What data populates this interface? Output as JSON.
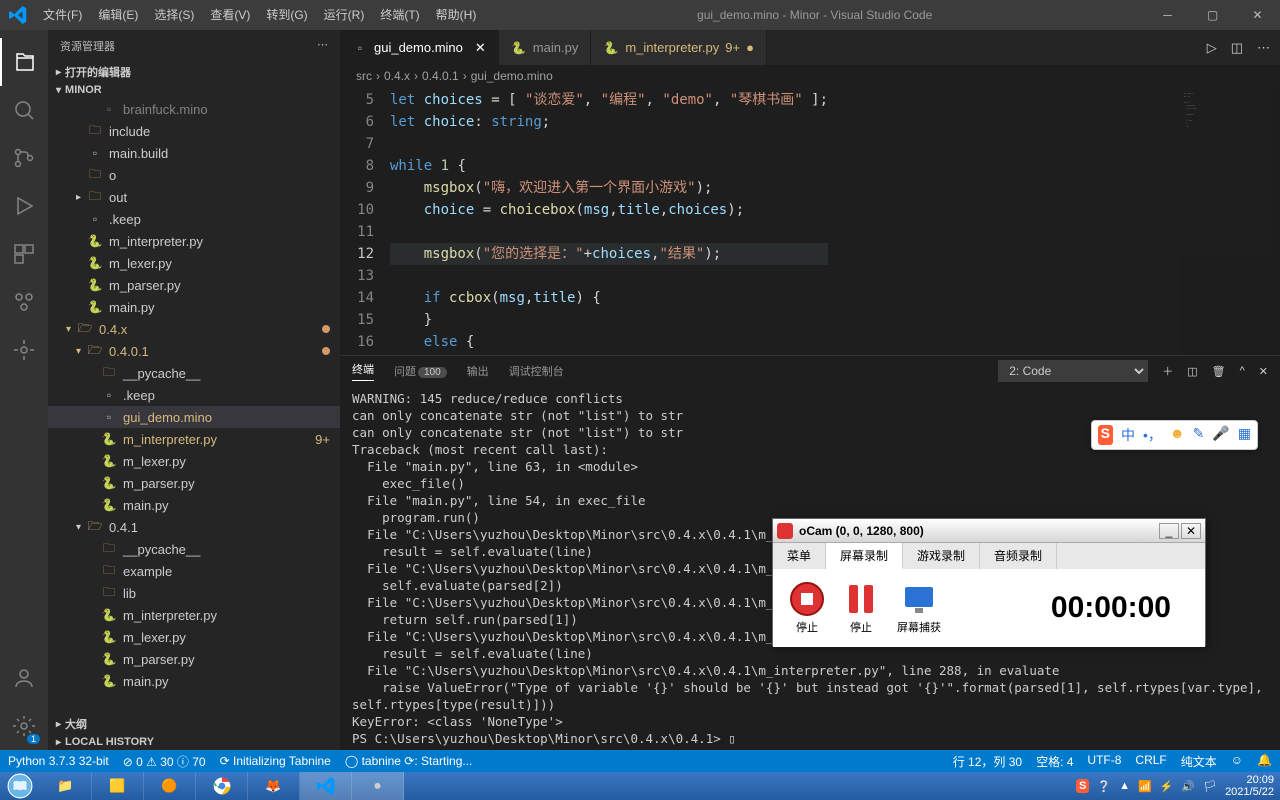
{
  "titlebar": {
    "menus": [
      "文件(F)",
      "编辑(E)",
      "选择(S)",
      "查看(V)",
      "转到(G)",
      "运行(R)",
      "终端(T)",
      "帮助(H)"
    ],
    "title": "gui_demo.mino - Minor - Visual Studio Code"
  },
  "sidebar": {
    "header": "资源管理器",
    "open_editors": "打开的编辑器",
    "workspace": "MINOR",
    "outline": "大纲",
    "localhistory": "LOCAL HISTORY",
    "tree": [
      {
        "depth": 2,
        "icon": "file",
        "label": "brainfuck.mino",
        "dim": true
      },
      {
        "depth": 1,
        "icon": "folder",
        "label": "include"
      },
      {
        "depth": 1,
        "icon": "file",
        "label": "main.build"
      },
      {
        "depth": 1,
        "icon": "folder",
        "label": "o"
      },
      {
        "depth": 1,
        "icon": "folder",
        "label": "out",
        "expandable": true
      },
      {
        "depth": 1,
        "icon": "file",
        "label": ".keep"
      },
      {
        "depth": 1,
        "icon": "py",
        "label": "m_interpreter.py"
      },
      {
        "depth": 1,
        "icon": "py",
        "label": "m_lexer.py"
      },
      {
        "depth": 1,
        "icon": "py",
        "label": "m_parser.py"
      },
      {
        "depth": 1,
        "icon": "py",
        "label": "main.py"
      },
      {
        "depth": 0,
        "icon": "folder-open",
        "label": "0.4.x",
        "yellow": true,
        "dot": true
      },
      {
        "depth": 1,
        "icon": "folder-open",
        "label": "0.4.0.1",
        "yellow": true,
        "dot": true
      },
      {
        "depth": 2,
        "icon": "folder",
        "label": "__pycache__"
      },
      {
        "depth": 2,
        "icon": "file",
        "label": ".keep"
      },
      {
        "depth": 2,
        "icon": "file",
        "label": "gui_demo.mino",
        "yellow": true,
        "active": true
      },
      {
        "depth": 2,
        "icon": "py",
        "label": "m_interpreter.py",
        "yellow": true,
        "badge": "9+"
      },
      {
        "depth": 2,
        "icon": "py",
        "label": "m_lexer.py"
      },
      {
        "depth": 2,
        "icon": "py",
        "label": "m_parser.py"
      },
      {
        "depth": 2,
        "icon": "py",
        "label": "main.py"
      },
      {
        "depth": 1,
        "icon": "folder-open",
        "label": "0.4.1"
      },
      {
        "depth": 2,
        "icon": "folder",
        "label": "__pycache__"
      },
      {
        "depth": 2,
        "icon": "folder",
        "label": "example"
      },
      {
        "depth": 2,
        "icon": "folder",
        "label": "lib"
      },
      {
        "depth": 2,
        "icon": "py",
        "label": "m_interpreter.py"
      },
      {
        "depth": 2,
        "icon": "py",
        "label": "m_lexer.py"
      },
      {
        "depth": 2,
        "icon": "py",
        "label": "m_parser.py"
      },
      {
        "depth": 2,
        "icon": "py",
        "label": "main.py"
      }
    ]
  },
  "tabs": [
    {
      "icon": "file",
      "label": "gui_demo.mino",
      "active": true,
      "close": true
    },
    {
      "icon": "py",
      "label": "main.py"
    },
    {
      "icon": "py",
      "label": "m_interpreter.py",
      "mod": true,
      "badge": "9+"
    }
  ],
  "breadcrumb": [
    "src",
    "0.4.x",
    "0.4.0.1",
    "gui_demo.mino"
  ],
  "code": {
    "start": 5,
    "current": 12,
    "linesHtml": [
      "<span class='kw'>let</span> <span class='id'>choices</span> <span class='punc'>=</span> <span class='punc'>[</span> <span class='str'>\"谈恋爱\"</span><span class='punc'>,</span> <span class='str'>\"编程\"</span><span class='punc'>,</span> <span class='str'>\"demo\"</span><span class='punc'>,</span> <span class='str'>\"琴棋书画\"</span> <span class='punc'>]</span><span class='punc'>;</span>",
      "<span class='kw'>let</span> <span class='id'>choice</span><span class='punc'>:</span> <span class='kw'>string</span><span class='punc'>;</span>",
      "",
      "<span class='kw'>while</span> <span class='num'>1</span> <span class='punc'>{</span>",
      "    <span class='fn'>msgbox</span><span class='punc'>(</span><span class='str'>\"嗨，欢迎进入第一个界面小游戏\"</span><span class='punc'>)</span><span class='punc'>;</span>",
      "    <span class='id'>choice</span> <span class='punc'>=</span> <span class='fn'>choicebox</span><span class='punc'>(</span><span class='id'>msg</span><span class='punc'>,</span><span class='id'>title</span><span class='punc'>,</span><span class='id'>choices</span><span class='punc'>)</span><span class='punc'>;</span>",
      "",
      "    <span class='fn'>msgbox</span><span class='punc'>(</span><span class='str'>\"您的选择是：\"</span><span class='punc'>+</span><span class='id'>choices</span><span class='punc'>,</span><span class='str'>\"结果\"</span><span class='punc'>)</span><span class='punc'>;</span>",
      "",
      "    <span class='kw'>if</span> <span class='fn'>ccbox</span><span class='punc'>(</span><span class='id'>msg</span><span class='punc'>,</span><span class='id'>title</span><span class='punc'>)</span> <span class='punc'>{</span>",
      "    <span class='punc'>}</span>",
      "    <span class='kw'>else</span> <span class='punc'>{</span>"
    ]
  },
  "panel": {
    "tabs": {
      "terminal": "终端",
      "problems": "问题",
      "problems_count": "100",
      "output": "输出",
      "debug": "调试控制台"
    },
    "dropdown": "2: Code",
    "text": "WARNING: 145 reduce/reduce conflicts\ncan only concatenate str (not \"list\") to str\ncan only concatenate str (not \"list\") to str\nTraceback (most recent call last):\n  File \"main.py\", line 63, in <module>\n    exec_file()\n  File \"main.py\", line 54, in exec_file\n    program.run()\n  File \"C:\\Users\\yuzhou\\Desktop\\Minor\\src\\0.4.x\\0.4.1\\m_i\n    result = self.evaluate(line)\n  File \"C:\\Users\\yuzhou\\Desktop\\Minor\\src\\0.4.x\\0.4.1\\m_i\n    self.evaluate(parsed[2])\n  File \"C:\\Users\\yuzhou\\Desktop\\Minor\\src\\0.4.x\\0.4.1\\m_i\n    return self.run(parsed[1])\n  File \"C:\\Users\\yuzhou\\Desktop\\Minor\\src\\0.4.x\\0.4.1\\m_i\n    result = self.evaluate(line)\n  File \"C:\\Users\\yuzhou\\Desktop\\Minor\\src\\0.4.x\\0.4.1\\m_interpreter.py\", line 288, in evaluate\n    raise ValueError(\"Type of variable '{}' should be '{}' but instead got '{}'\".format(parsed[1], self.rtypes[var.type], self.rtypes[type(result)]))\nKeyError: <class 'NoneType'>\nPS C:\\Users\\yuzhou\\Desktop\\Minor\\src\\0.4.x\\0.4.1> ▯"
  },
  "status": {
    "python": "Python 3.7.3 32-bit",
    "errors": "⊘ 0 ⚠ 30 ⓘ 70",
    "tabnine1": "⟳ Initializing Tabnine",
    "tabnine2": "◯ tabnine ⟳: Starting...",
    "pos": "行 12，列 30",
    "spaces": "空格: 4",
    "enc": "UTF-8",
    "eol": "CRLF",
    "lang": "纯文本",
    "bell": "🔔"
  },
  "ocam": {
    "title": "oCam (0, 0, 1280, 800)",
    "menu": "菜单",
    "tabs": [
      "屏幕录制",
      "游戏录制",
      "音频录制"
    ],
    "stop": "停止",
    "pause": "停止",
    "capture": "屏幕捕获",
    "timer": "00:00:00"
  },
  "taskbar": {
    "time": "20:09",
    "date": "2021/5/22"
  }
}
